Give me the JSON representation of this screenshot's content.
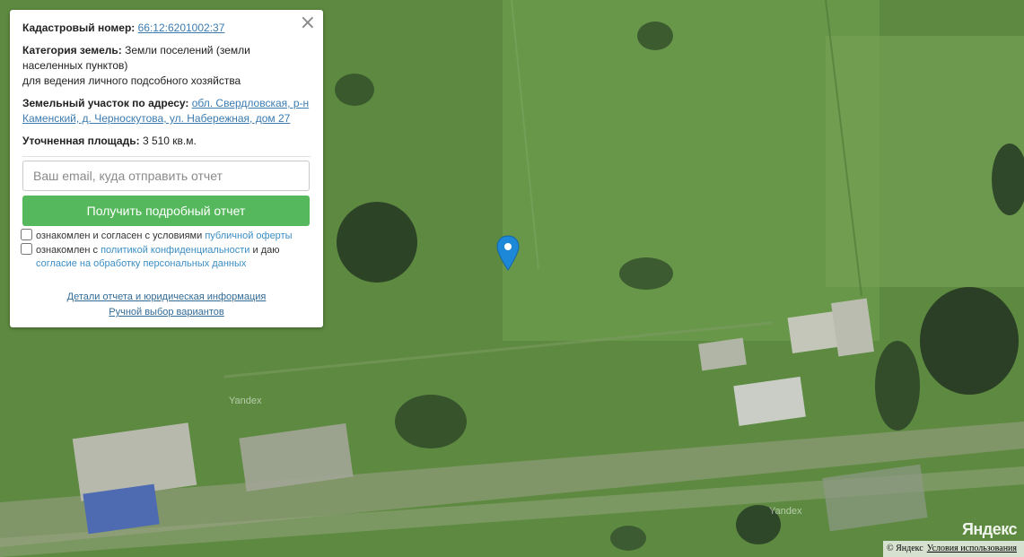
{
  "panel": {
    "cadastral_label": "Кадастровый номер:",
    "cadastral_number": "66:12:6201002:37",
    "category_label": "Категория земель:",
    "category_value": "Земли поселений (земли населенных пунктов)",
    "category_use": "для ведения личного подсобного хозяйства",
    "address_label": "Земельный участок по адресу:",
    "address_value": "обл. Свердловская, р-н Каменский, д. Черноскутова, ул. Набережная, дом 27",
    "area_label": "Уточненная площадь:",
    "area_value": "3 510 кв.м.",
    "close_symbol": "×",
    "email_placeholder": "Ваш email, куда отправить отчет",
    "submit_label": "Получить подробный отчет",
    "check1_text": "ознакомлен и согласен с условиями",
    "check1_link": "публичной оферты",
    "check2_text_a": "ознакомлен с",
    "check2_link_a": "политикой конфиденциальности",
    "check2_text_b": "и даю",
    "check2_link_b": "согласие на обработку персональных данных",
    "link_details": "Детали отчета и юридическая информация",
    "link_manual": "Ручной выбор вариантов"
  },
  "map": {
    "watermark_1": "Yandex",
    "watermark_2": "Yandex",
    "logo": "Яндекс",
    "copyright": "© Яндекс",
    "terms_link": "Условия использования",
    "pin_color": "#1e88d8",
    "icons": [
      "close-icon",
      "map-pin-icon"
    ]
  }
}
